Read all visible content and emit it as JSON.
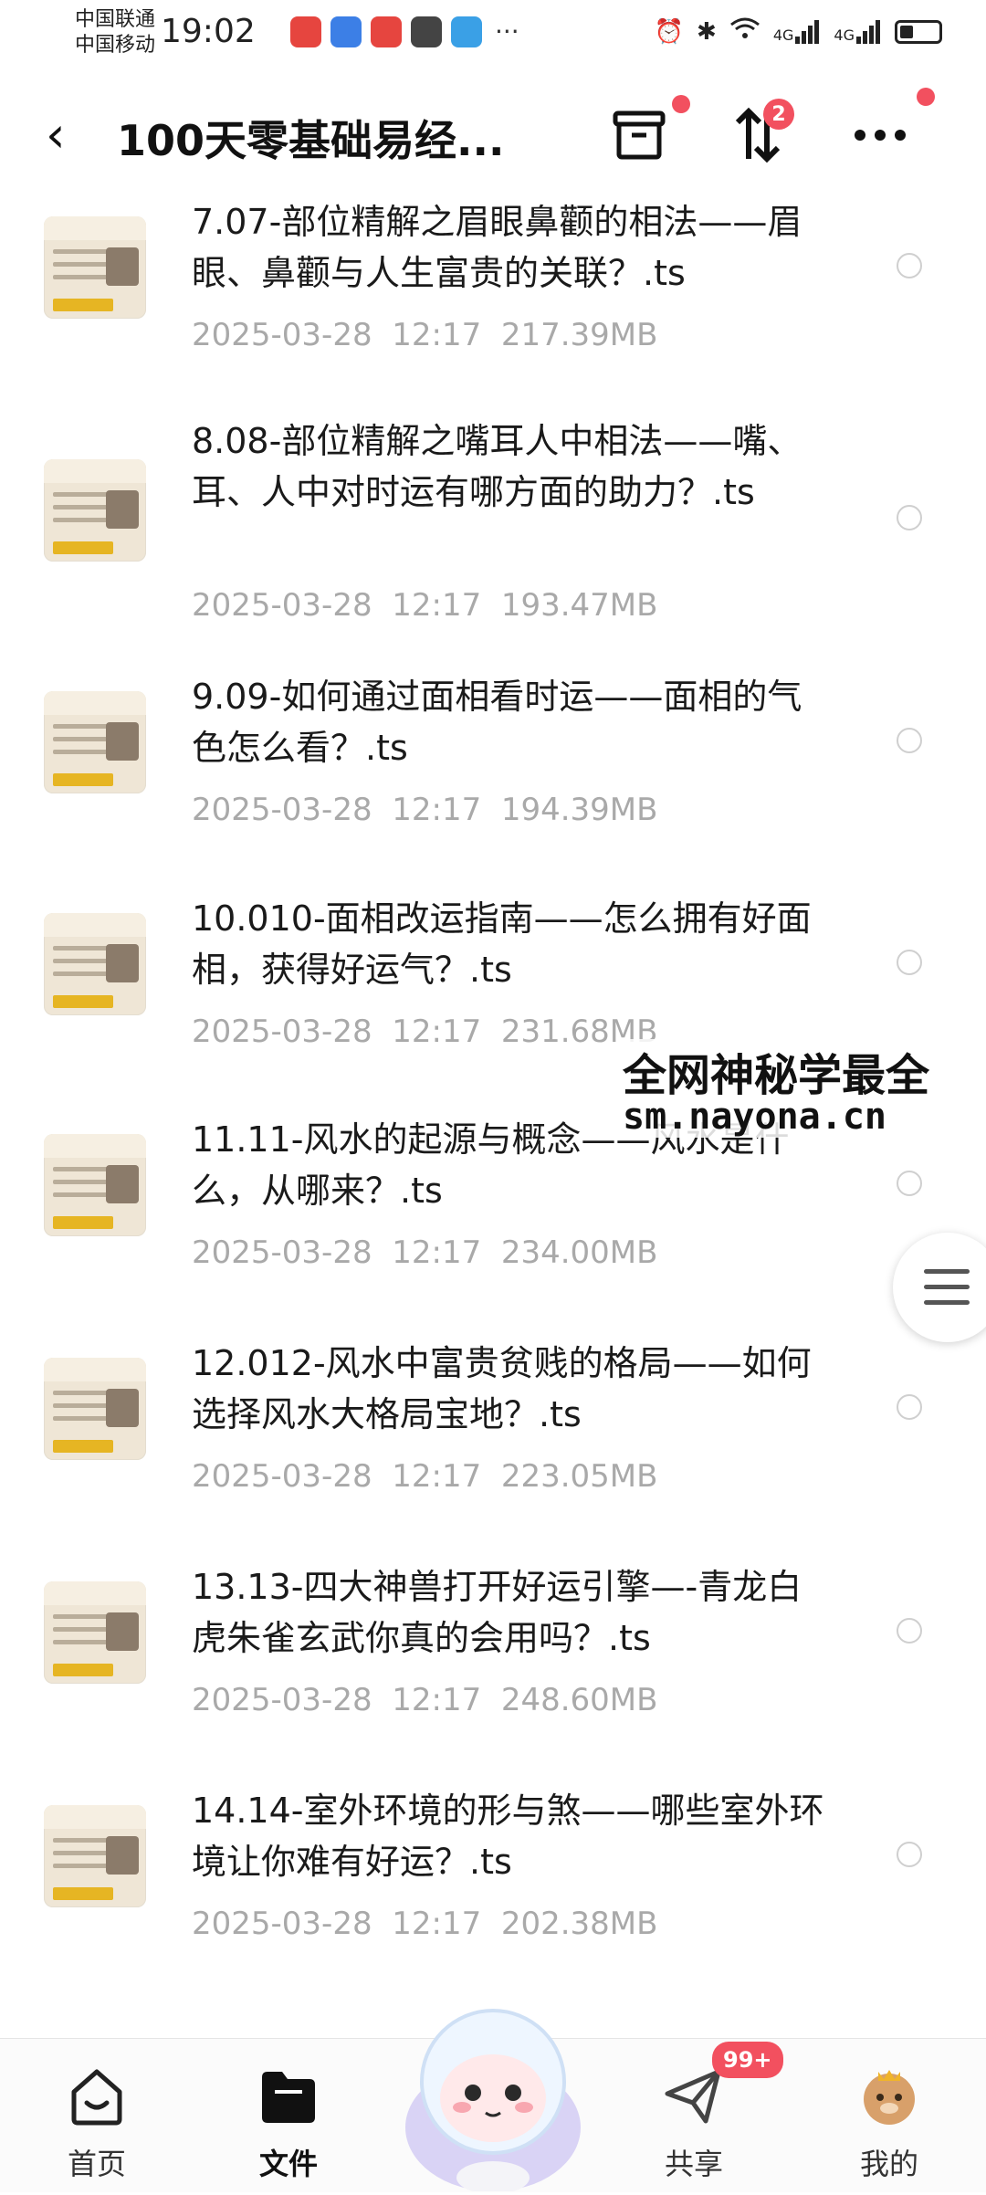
{
  "status_bar": {
    "carrier1": "中国联通",
    "carrier2": "中国移动",
    "time": "19:02",
    "net1": "4G",
    "net2": "4G"
  },
  "header": {
    "title": "100天零基础易经...",
    "transfer_badge": "2"
  },
  "files": [
    {
      "name": "7.07-部位精解之眉眼鼻颧的相法——眉眼、鼻颧与人生富贵的关联？.ts",
      "date": "2025-03-28",
      "time": "12:17",
      "size": "217.39MB"
    },
    {
      "name": "8.08-部位精解之嘴耳人中相法——嘴、耳、人中对时运有哪方面的助力？.ts",
      "date": "2025-03-28",
      "time": "12:17",
      "size": "193.47MB"
    },
    {
      "name": "9.09-如何通过面相看时运——面相的气色怎么看？.ts",
      "date": "2025-03-28",
      "time": "12:17",
      "size": "194.39MB"
    },
    {
      "name": "10.010-面相改运指南——怎么拥有好面相，获得好运气？.ts",
      "date": "2025-03-28",
      "time": "12:17",
      "size": "231.68MB"
    },
    {
      "name": "11.11-风水的起源与概念——风水是什么，从哪来？.ts",
      "date": "2025-03-28",
      "time": "12:17",
      "size": "234.00MB"
    },
    {
      "name": "12.012-风水中富贵贫贱的格局——如何选择风水大格局宝地？.ts",
      "date": "2025-03-28",
      "time": "12:17",
      "size": "223.05MB"
    },
    {
      "name": "13.13-四大神兽打开好运引擎—-青龙白虎朱雀玄武你真的会用吗？.ts",
      "date": "2025-03-28",
      "time": "12:17",
      "size": "248.60MB"
    },
    {
      "name": "14.14-室外环境的形与煞——哪些室外环境让你难有好运？.ts",
      "date": "2025-03-28",
      "time": "12:17",
      "size": "202.38MB"
    }
  ],
  "watermark": {
    "line1": "全网神秘学最全",
    "line2": "sm.nayona.cn"
  },
  "bottom_nav": {
    "home": "首页",
    "files": "文件",
    "share": "共享",
    "mine": "我的",
    "share_badge": "99+"
  },
  "colors": {
    "badge_red": "#f2505f",
    "meta_gray": "#a9a9a9"
  }
}
